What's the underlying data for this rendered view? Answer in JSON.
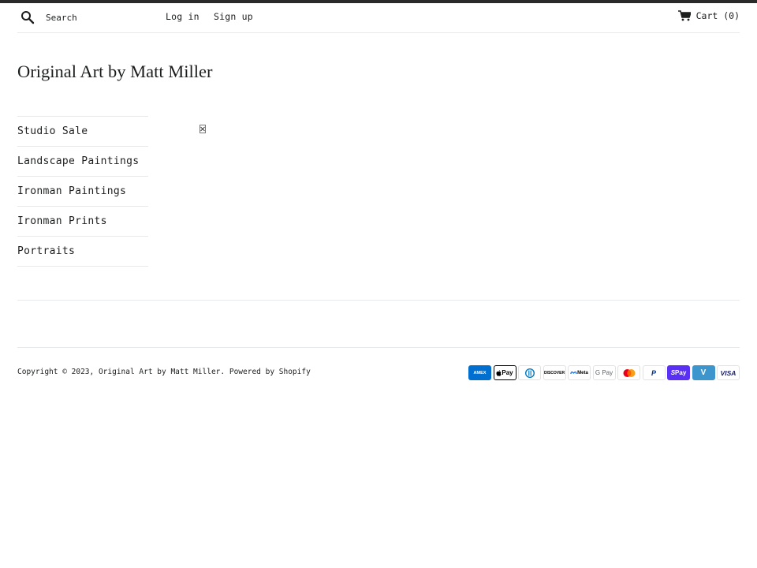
{
  "header": {
    "search_placeholder": "Search",
    "login_label": "Log in",
    "signup_label": "Sign up",
    "cart_label": "Cart (0)"
  },
  "site": {
    "title": "Original Art by Matt Miller"
  },
  "sidebar": {
    "items": [
      {
        "label": "Studio Sale"
      },
      {
        "label": "Landscape Paintings"
      },
      {
        "label": "Ironman Paintings"
      },
      {
        "label": "Ironman Prints"
      },
      {
        "label": "Portraits"
      }
    ]
  },
  "footer": {
    "copyright_prefix": "Copyright © 2023, ",
    "store_link": "Original Art by Matt Miller",
    "separator": ". ",
    "powered_by": "Powered by Shopify"
  },
  "payment_icons": [
    {
      "name": "american-express",
      "text": "AMEX"
    },
    {
      "name": "apple-pay",
      "text": "Pay"
    },
    {
      "name": "diners-club",
      "text": ""
    },
    {
      "name": "discover",
      "text": "DISCOVER"
    },
    {
      "name": "meta-pay",
      "text": "Meta"
    },
    {
      "name": "google-pay",
      "text": "G Pay"
    },
    {
      "name": "mastercard",
      "text": ""
    },
    {
      "name": "paypal",
      "text": "P"
    },
    {
      "name": "shop-pay",
      "text": "Pay"
    },
    {
      "name": "venmo",
      "text": "V"
    },
    {
      "name": "visa",
      "text": "VISA"
    }
  ],
  "colors": {
    "text": "#1c1d1d",
    "border": "#e8e9eb",
    "top_stripe": "#2a2a2a"
  }
}
